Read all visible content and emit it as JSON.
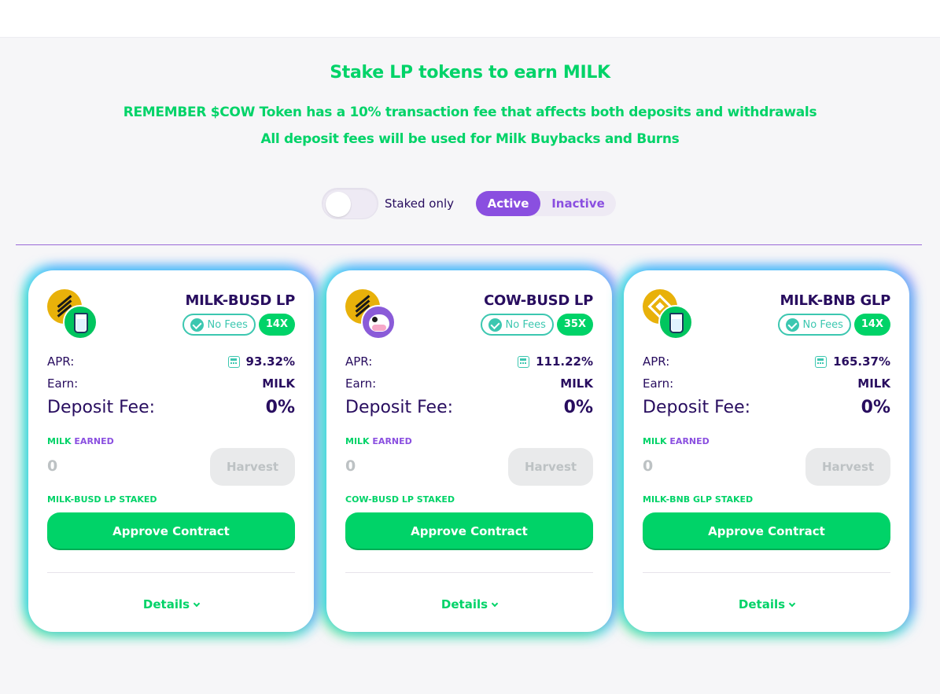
{
  "hero": {
    "title": "Stake LP tokens to earn MILK",
    "line1": "REMEMBER $COW Token has a 10% transaction fee that affects both deposits and withdrawals",
    "line2": "All deposit fees will be used for Milk Buybacks and Burns"
  },
  "filters": {
    "staked_only_label": "Staked only",
    "staked_only_on": false,
    "tabs": [
      "Active",
      "Inactive"
    ],
    "selected_tab": "Active"
  },
  "colors": {
    "accent_green": "#00d368",
    "accent_purple": "#8a4fe0",
    "teal": "#3cc7b0",
    "text_dark": "#280d5f"
  },
  "labels": {
    "apr": "APR:",
    "earn": "Earn:",
    "deposit_fee": "Deposit Fee:",
    "earned_token": "MILK",
    "earned_word": "EARNED",
    "harvest": "Harvest",
    "approve": "Approve Contract",
    "details": "Details",
    "no_fees": "No Fees"
  },
  "farms": [
    {
      "name": "MILK-BUSD LP",
      "multiplier": "14X",
      "apr": "93.32%",
      "earn": "MILK",
      "deposit_fee": "0%",
      "earned": "0",
      "staked_label": "MILK-BUSD LP STAKED",
      "token_icons": [
        "busd-icon",
        "milk-icon"
      ]
    },
    {
      "name": "COW-BUSD LP",
      "multiplier": "35X",
      "apr": "111.22%",
      "earn": "MILK",
      "deposit_fee": "0%",
      "earned": "0",
      "staked_label": "COW-BUSD LP STAKED",
      "token_icons": [
        "busd-icon",
        "cow-icon"
      ]
    },
    {
      "name": "MILK-BNB GLP",
      "multiplier": "14X",
      "apr": "165.37%",
      "earn": "MILK",
      "deposit_fee": "0%",
      "earned": "0",
      "staked_label": "MILK-BNB GLP STAKED",
      "token_icons": [
        "bnb-icon",
        "milk-icon"
      ]
    }
  ]
}
